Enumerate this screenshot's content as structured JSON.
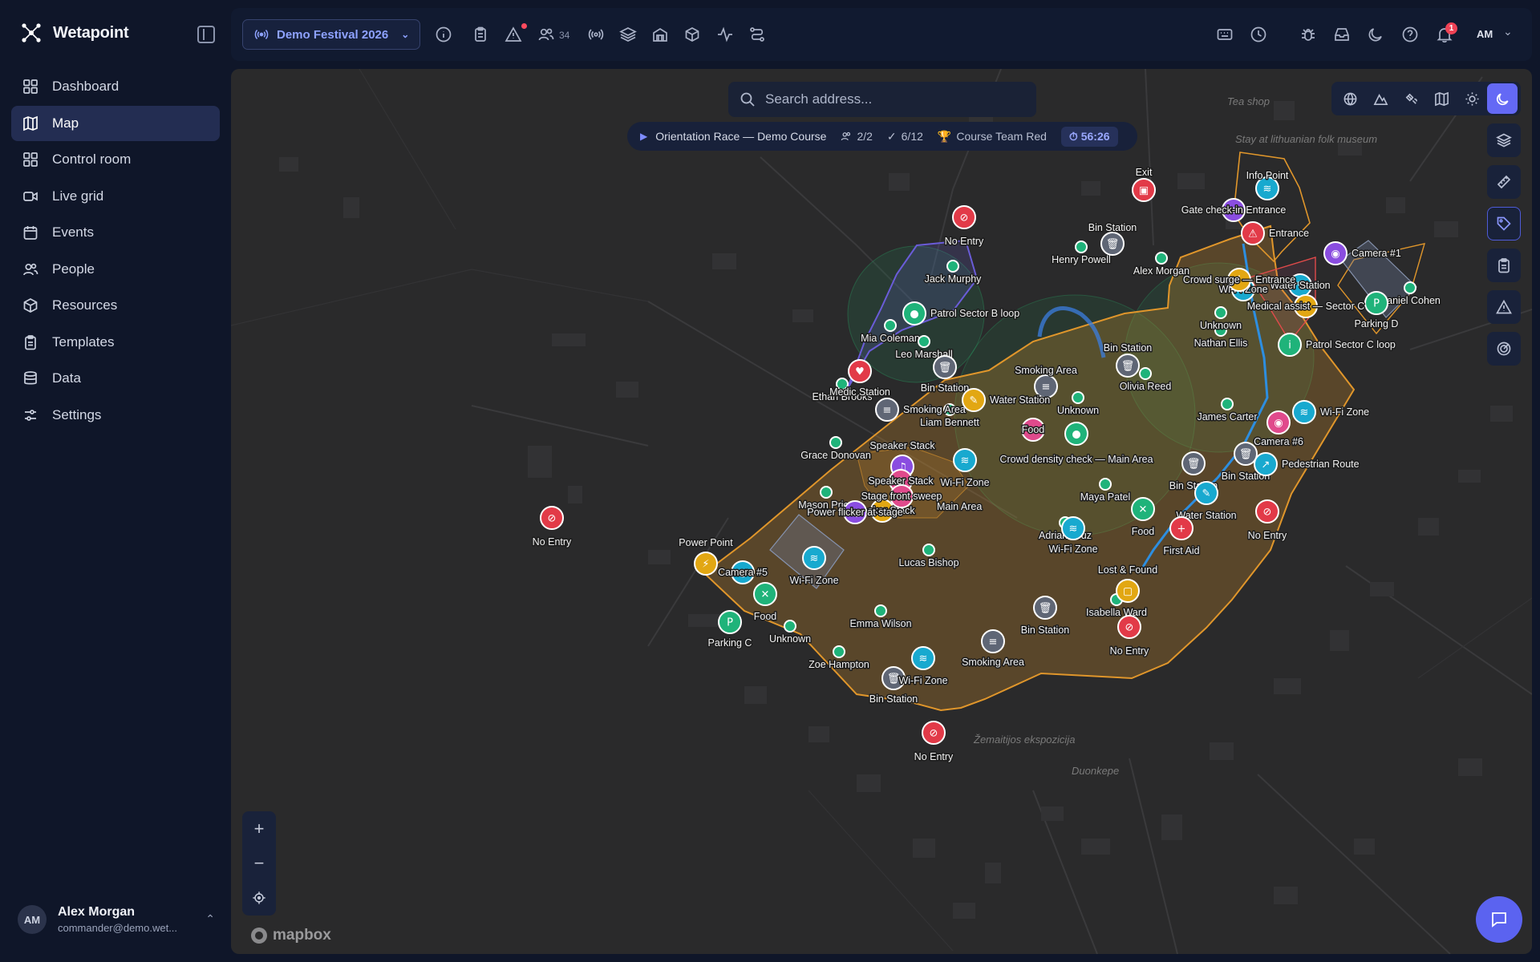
{
  "app": {
    "name": "Wetapoint"
  },
  "sidebar": {
    "items": [
      {
        "label": "Dashboard",
        "icon": "dashboard-icon"
      },
      {
        "label": "Map",
        "icon": "map-icon",
        "active": true
      },
      {
        "label": "Control room",
        "icon": "control-room-icon"
      },
      {
        "label": "Live grid",
        "icon": "video-icon"
      },
      {
        "label": "Events",
        "icon": "calendar-icon"
      },
      {
        "label": "People",
        "icon": "people-icon"
      },
      {
        "label": "Resources",
        "icon": "box-icon"
      },
      {
        "label": "Templates",
        "icon": "clipboard-icon"
      },
      {
        "label": "Data",
        "icon": "database-icon"
      },
      {
        "label": "Settings",
        "icon": "sliders-icon"
      }
    ],
    "user": {
      "initials": "AM",
      "name": "Alex Morgan",
      "email": "commander@demo.wet..."
    }
  },
  "topbar": {
    "festival": "Demo Festival 2026",
    "people_count": "34",
    "notifications_count": "1",
    "user_initials": "AM"
  },
  "map": {
    "search_placeholder": "Search address...",
    "race": {
      "name": "Orientation Race — Demo Course",
      "teams": "2/2",
      "checkpoints": "6/12",
      "leader": "Course Team Red",
      "timer": "56:26"
    },
    "attribution": "mapbox",
    "colors": {
      "zone_orange": "#e0962b",
      "route_blue": "#2d8ee0",
      "patrol_purple": "#6a5cd8",
      "green_marker": "#1fb37a",
      "red_marker": "#e23a48",
      "cyan_marker": "#18a9cf",
      "gray_marker": "#5f6675",
      "yellow_marker": "#e2a713",
      "pink_marker": "#e04a8c",
      "violet_marker": "#8a4de0"
    },
    "place_labels": [
      "Tea shop",
      "Stay at lithuanian folk museum",
      "Žemaitijos ekspozicija",
      "Duonkepe"
    ],
    "markers": [
      {
        "label": "No Entry",
        "kind": "no-entry",
        "color": "red"
      },
      {
        "label": "No Entry",
        "kind": "no-entry",
        "color": "red"
      },
      {
        "label": "No Entry",
        "kind": "no-entry",
        "color": "red"
      },
      {
        "label": "No Entry",
        "kind": "no-entry",
        "color": "red"
      },
      {
        "label": "No Entry",
        "kind": "no-entry",
        "color": "red"
      },
      {
        "label": "Exit",
        "kind": "exit",
        "color": "red"
      },
      {
        "label": "Entrance",
        "kind": "warning",
        "color": "red"
      },
      {
        "label": "Bin Station",
        "kind": "bin",
        "color": "gray"
      },
      {
        "label": "Bin Station",
        "kind": "bin",
        "color": "gray"
      },
      {
        "label": "Bin Station",
        "kind": "bin",
        "color": "gray"
      },
      {
        "label": "Bin Station",
        "kind": "bin",
        "color": "gray"
      },
      {
        "label": "Bin Station",
        "kind": "bin",
        "color": "gray"
      },
      {
        "label": "Bin Station",
        "kind": "bin",
        "color": "gray"
      },
      {
        "label": "Bin Station",
        "kind": "bin",
        "color": "gray"
      },
      {
        "label": "Info Point",
        "kind": "wifi",
        "color": "cyan"
      },
      {
        "label": "Camera #1",
        "kind": "camera",
        "color": "violet"
      },
      {
        "label": "Parking D",
        "kind": "parking",
        "color": "green"
      },
      {
        "label": "Parking C",
        "kind": "parking",
        "color": "green"
      },
      {
        "label": "Patrol Sector B loop",
        "kind": "pin",
        "color": "green"
      },
      {
        "label": "Patrol Sector C loop",
        "kind": "info",
        "color": "green"
      },
      {
        "label": "Medic Station",
        "kind": "heart",
        "color": "red"
      },
      {
        "label": "Smoking Area",
        "kind": "smoke",
        "color": "gray"
      },
      {
        "label": "Smoking Area",
        "kind": "smoke",
        "color": "gray"
      },
      {
        "label": "Smoking Area",
        "kind": "smoke",
        "color": "gray"
      },
      {
        "label": "Water Station",
        "kind": "water",
        "color": "yellow"
      },
      {
        "label": "Water Station",
        "kind": "water",
        "color": "cyan"
      },
      {
        "label": "Water Station",
        "kind": "water",
        "color": "cyan"
      },
      {
        "label": "Wi-Fi Zone",
        "kind": "wifi",
        "color": "cyan"
      },
      {
        "label": "Wi-Fi Zone",
        "kind": "wifi",
        "color": "cyan"
      },
      {
        "label": "Wi-Fi Zone",
        "kind": "wifi",
        "color": "cyan"
      },
      {
        "label": "Wi-Fi Zone",
        "kind": "wifi",
        "color": "cyan"
      },
      {
        "label": "Wi-Fi Zone",
        "kind": "wifi",
        "color": "cyan"
      },
      {
        "label": "Wi-Fi Zone",
        "kind": "wifi",
        "color": "cyan"
      },
      {
        "label": "Food",
        "kind": "food",
        "color": "green"
      },
      {
        "label": "Food",
        "kind": "food",
        "color": "green"
      },
      {
        "label": "Food",
        "kind": "food",
        "color": "pink"
      },
      {
        "label": "First Aid",
        "kind": "plus",
        "color": "red"
      },
      {
        "label": "Lost & Found",
        "kind": "box",
        "color": "yellow"
      },
      {
        "label": "Power Point",
        "kind": "power",
        "color": "yellow"
      },
      {
        "label": "Camera #6",
        "kind": "camera",
        "color": "pink"
      },
      {
        "label": "Camera #5",
        "kind": "camera",
        "color": "cyan"
      },
      {
        "label": "Speaker Stack",
        "kind": "speaker",
        "color": "violet"
      },
      {
        "label": "Speaker Stack",
        "kind": "speaker",
        "color": "pink"
      },
      {
        "label": "Speaker Stack",
        "kind": "speaker",
        "color": "yellow"
      },
      {
        "label": "Stage front sweep",
        "kind": "speaker",
        "color": "pink"
      },
      {
        "label": "Power flicker at stage",
        "kind": "speaker",
        "color": "violet"
      },
      {
        "label": "Crowd density check — Main Area",
        "kind": "pin",
        "color": "green"
      },
      {
        "label": "Crowd surge — Entrance",
        "kind": "alert",
        "color": "yellow"
      },
      {
        "label": "Gate check-in Entrance",
        "kind": "wifi",
        "color": "violet"
      },
      {
        "label": "Medical assist — Sector C",
        "kind": "alert",
        "color": "yellow"
      },
      {
        "label": "Pedestrian Route",
        "kind": "walk",
        "color": "cyan"
      },
      {
        "label": "Unknown",
        "kind": "dot",
        "color": "green"
      },
      {
        "label": "Main Area",
        "kind": "text",
        "color": "none"
      }
    ],
    "people": [
      "Jack Murphy",
      "Mia Coleman",
      "Leo Marshall",
      "Ethan Brooks",
      "Liam Bennett",
      "Grace Donovan",
      "Mason Price",
      "Lucas Bishop",
      "Emma Wilson",
      "Zoe Hampton",
      "Henry Powell",
      "Alex Morgan",
      "Nathan Ellis",
      "Olivia Reed",
      "James Carter",
      "Maya Patel",
      "Adrian Cruz",
      "Isabella Ward",
      "Daniel Cohen",
      "Unknown",
      "Unknown",
      "Unknown"
    ]
  }
}
